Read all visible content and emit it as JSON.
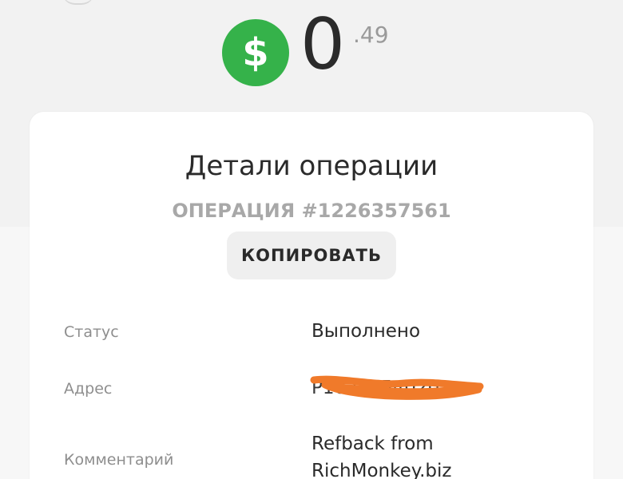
{
  "balance": {
    "integer": "0",
    "fraction": ".49",
    "currency_icon": "dollar-icon",
    "icon_color": "#35b24a"
  },
  "details": {
    "title": "Детали операции",
    "operation_number": "ОПЕРАЦИЯ #1226357561",
    "copy_label": "КОПИРОВАТЬ",
    "rows": [
      {
        "label": "Статус",
        "value": "Выполнено"
      },
      {
        "label": "Адрес",
        "value": "P1021154020"
      },
      {
        "label": "Комментарий",
        "value_line1": "Refback from",
        "value_line2": "RichMonkey.biz"
      }
    ],
    "redaction_color": "#f07a2a"
  }
}
